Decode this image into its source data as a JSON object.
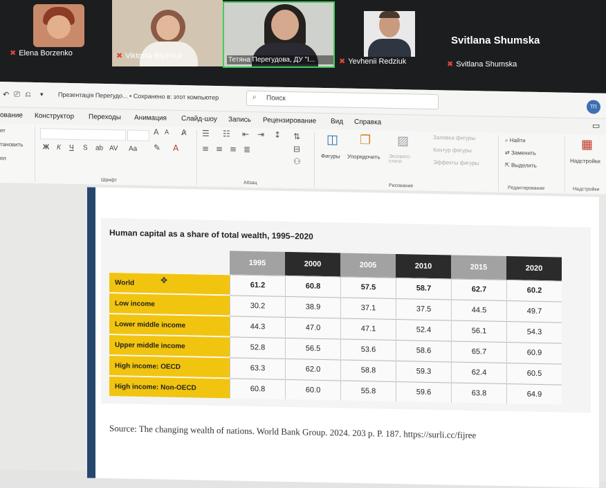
{
  "meeting": {
    "participants": [
      {
        "name": "Elena Borzenko",
        "muted": true,
        "bg": "#2a2b2e",
        "av": "#b0563c"
      },
      {
        "name": "Viktoriia Blyzniuk",
        "muted": true,
        "bg": "#cfc4b2",
        "av": "#8a5646"
      },
      {
        "name": "Тетяна Перегудова, ДУ \"І...",
        "muted": false,
        "bg": "#c9ccc7",
        "av": "#2e2a2a"
      },
      {
        "name": "Yevhenii Redziuk",
        "muted": true,
        "bg": "#e6e6e6",
        "av": "#3a3e46"
      },
      {
        "name": "Svitlana Shumska",
        "muted": true,
        "bg": "#1c1d1f",
        "av": "#1c1d1f"
      }
    ],
    "big_name": "Svitlana Shumska"
  },
  "titlebar": {
    "doc_title": "Презентація Перегудо... • Сохранено в: этот компьютер",
    "search_placeholder": "Поиск",
    "avatar_initials": "ТП"
  },
  "tabs": [
    "ование",
    "Конструктор",
    "Переходы",
    "Анимация",
    "Слайд-шоу",
    "Запись",
    "Рецензирование",
    "Вид",
    "Справка"
  ],
  "ribbon": {
    "left": [
      "ет",
      "тановить",
      "ел"
    ],
    "groups": {
      "font": "Шрифт",
      "paragraph": "Абзац",
      "drawing": "Рисование",
      "editing": "Редактирование",
      "addins": "Надстройки"
    },
    "shapes": "Фигуры",
    "arrange": "Упорядочить",
    "quick_styles": "Экспресс-стили",
    "shape_fill": "Заливка фигуры",
    "shape_outline": "Контур фигуры",
    "shape_effects": "Эффекты фигуры",
    "find": "Найти",
    "replace": "Заменить",
    "select": "Выделить",
    "addins_btn": "Надстройки"
  },
  "table": {
    "title": "Human capital as a share of total wealth, 1995–2020",
    "years": [
      "1995",
      "2000",
      "2005",
      "2010",
      "2015",
      "2020"
    ],
    "header_colors": [
      "#a2a2a2",
      "#2b2b2b",
      "#a2a2a2",
      "#2b2b2b",
      "#a2a2a2",
      "#2b2b2b"
    ],
    "row_color": "#f1c40f",
    "rows": [
      {
        "label": "World",
        "values": [
          "61.2",
          "60.8",
          "57.5",
          "58.7",
          "62.7",
          "60.2"
        ]
      },
      {
        "label": "Low income",
        "values": [
          "30.2",
          "38.9",
          "37.1",
          "37.5",
          "44.5",
          "49.7"
        ]
      },
      {
        "label": "Lower middle income",
        "values": [
          "44.3",
          "47.0",
          "47.1",
          "52.4",
          "56.1",
          "54.3"
        ]
      },
      {
        "label": "Upper middle income",
        "values": [
          "52.8",
          "56.5",
          "53.6",
          "58.6",
          "65.7",
          "60.9"
        ]
      },
      {
        "label": "High income: OECD",
        "values": [
          "63.3",
          "62.0",
          "58.8",
          "59.3",
          "62.4",
          "60.5"
        ]
      },
      {
        "label": "High income: Non-OECD",
        "values": [
          "60.8",
          "60.0",
          "55.8",
          "59.6",
          "63.8",
          "64.9"
        ]
      }
    ]
  },
  "source": "Source: The changing wealth of nations. World Bank Group. 2024. 203 p. P. 187. https://surli.cc/fijree"
}
